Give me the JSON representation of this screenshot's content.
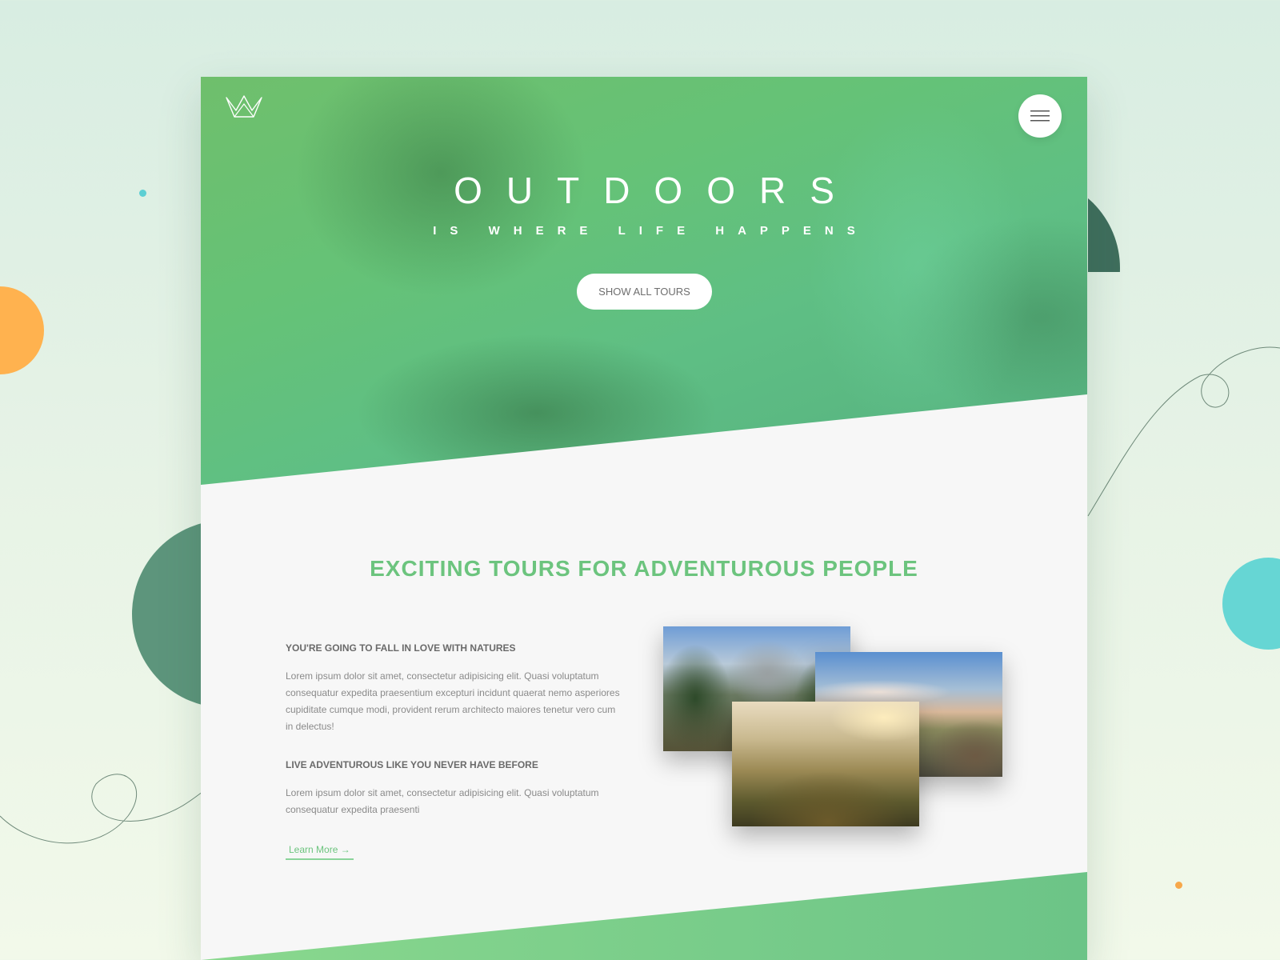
{
  "hero": {
    "title": "OUTDOORS",
    "subtitle": "IS WHERE LIFE HAPPENS",
    "cta_label": "SHOW ALL TOURS"
  },
  "header": {
    "logo_icon": "crown-logo-icon",
    "menu_icon": "hamburger-menu-icon"
  },
  "section": {
    "title": "EXCITING TOURS FOR ADVENTUROUS PEOPLE",
    "blocks": [
      {
        "heading": "YOU'RE GOING TO FALL IN LOVE WITH NATURES",
        "body": "Lorem ipsum dolor sit amet, consectetur adipisicing elit. Quasi voluptatum consequatur expedita praesentium excepturi incidunt quaerat nemo asperiores cupiditate cumque modi, provident rerum architecto maiores tenetur vero cum in delectus!"
      },
      {
        "heading": "LIVE ADVENTUROUS LIKE YOU NEVER HAVE BEFORE",
        "body": "Lorem ipsum dolor sit amet, consectetur adipisicing elit. Quasi voluptatum consequatur expedita praesenti"
      }
    ],
    "link_label": "Learn More →"
  },
  "colors": {
    "accent_green": "#6cc47e",
    "hero_green": "#65c277",
    "orange": "#ffb24f",
    "teal": "#66d6d4",
    "dark_green": "#3f6e5d"
  }
}
